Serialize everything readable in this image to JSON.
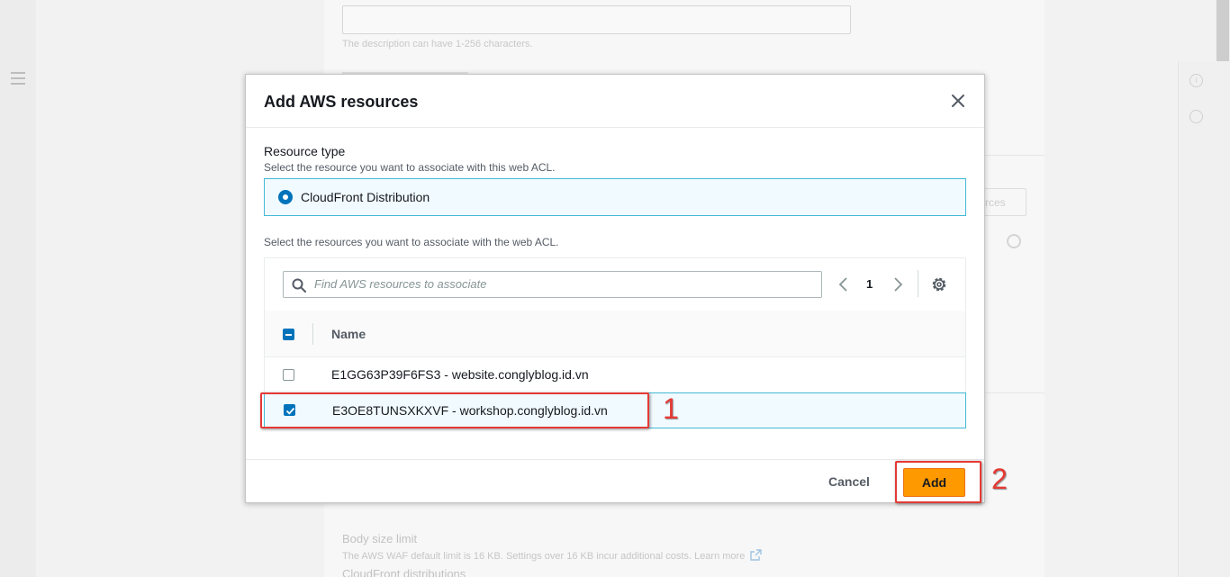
{
  "background": {
    "description_hint": "The description can have 1-256 characters.",
    "ghost_button_label": "rces",
    "body_size_title": "Body size limit",
    "body_size_hint": "The AWS WAF default limit is 16 KB. Settings over 16 KB incur additional costs. Learn more",
    "cloudfront_heading": "CloudFront distributions",
    "info_icon_glyph": "i"
  },
  "modal": {
    "title": "Add AWS resources",
    "resource_type": {
      "label": "Resource type",
      "description": "Select the resource you want to associate with this web ACL.",
      "selected_option": "CloudFront Distribution"
    },
    "select_description": "Select the resources you want to associate with the web ACL.",
    "search": {
      "placeholder": "Find AWS resources to associate"
    },
    "pagination": {
      "current_page": "1"
    },
    "table": {
      "columns": [
        "Name"
      ],
      "rows": [
        {
          "name": "E1GG63P39F6FS3 - website.conglyblog.id.vn",
          "checked": false
        },
        {
          "name": "E3OE8TUNSXKXVF - workshop.conglyblog.id.vn",
          "checked": true
        }
      ]
    },
    "footer": {
      "cancel_label": "Cancel",
      "add_label": "Add"
    }
  },
  "annotations": {
    "step1": "1",
    "step2": "2",
    "color": "#e53935"
  },
  "colors": {
    "accent_orange": "#ff9900",
    "accent_blue": "#0073bb",
    "selected_border": "#44b9d6"
  }
}
